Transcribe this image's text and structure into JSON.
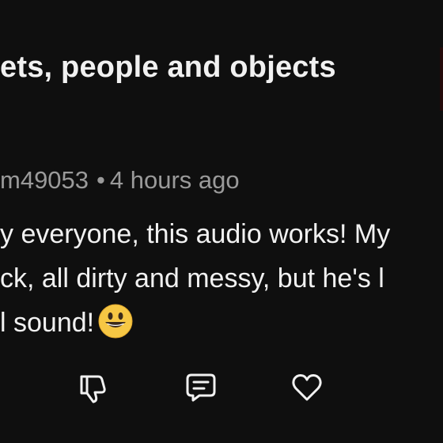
{
  "header": {
    "title_fragment": "ets, people and objects"
  },
  "comment": {
    "author": "m49053",
    "separator": "•",
    "time": "4 hours ago",
    "lines": [
      "y everyone, this audio works! My",
      "ck, all dirty and messy, but he's l",
      "l sound!"
    ],
    "emoji": "grinning-face-icon"
  },
  "actions": {
    "dislike_icon": "thumbs-down-icon",
    "reply_icon": "comment-icon",
    "like_icon": "heart-icon"
  },
  "colors": {
    "background": "#0f0f0f",
    "text": "#f1f1f1",
    "meta": "#9a9a9a"
  }
}
